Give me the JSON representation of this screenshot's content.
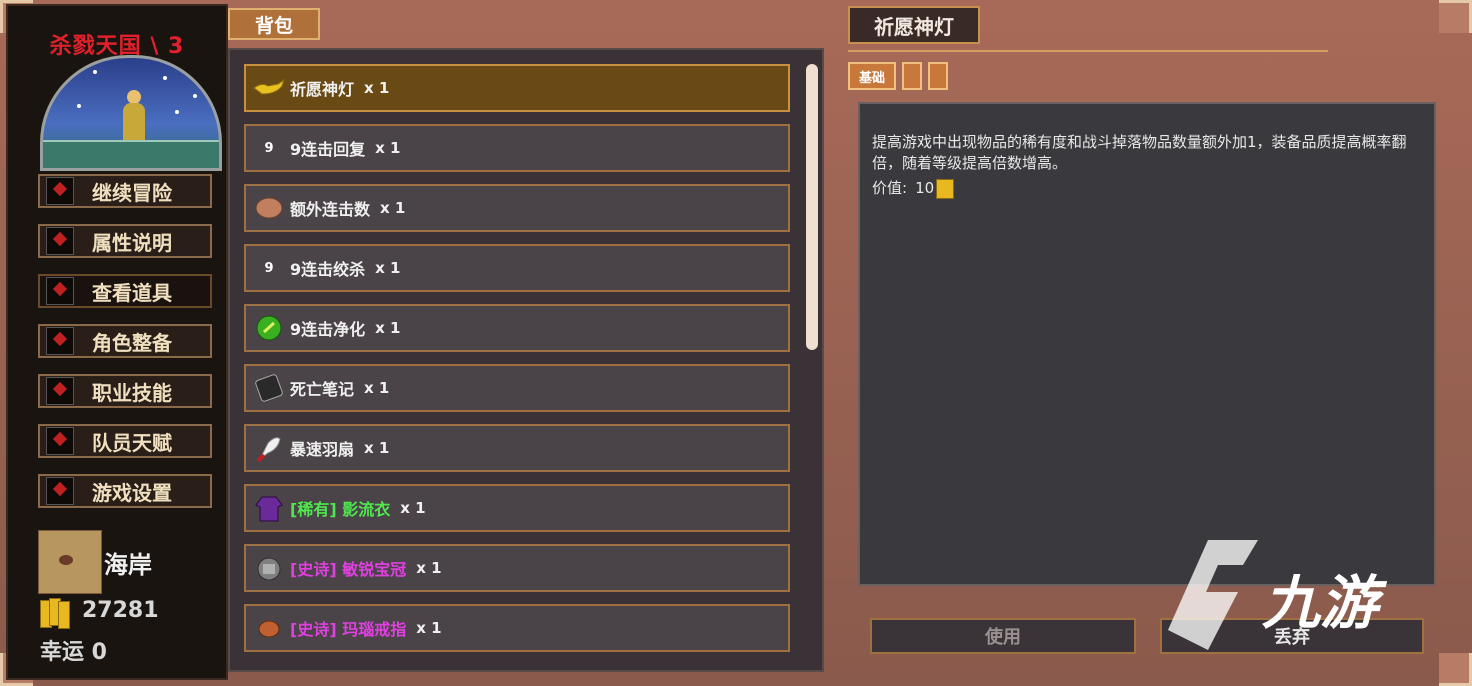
{
  "sidebar": {
    "title": "杀戮天国 \\ 3",
    "menu": [
      {
        "label": "继续冒险"
      },
      {
        "label": "属性说明"
      },
      {
        "label": "查看道具"
      },
      {
        "label": "角色整备"
      },
      {
        "label": "职业技能"
      },
      {
        "label": "队员天赋"
      },
      {
        "label": "游戏设置"
      }
    ],
    "active_index": 2,
    "location": "海岸",
    "gold": "27281",
    "luck": "幸运 0"
  },
  "inventory": {
    "tab_label": "背包",
    "items": [
      {
        "name": "祈愿神灯",
        "qty": "x 1",
        "icon": "magic-lamp-icon",
        "quality": "normal",
        "selected": true
      },
      {
        "name": "9连击回复",
        "qty": "x 1",
        "icon": "combo-heal-icon",
        "quality": "normal"
      },
      {
        "name": "额外连击数",
        "qty": "x 1",
        "icon": "rock-icon",
        "quality": "normal"
      },
      {
        "name": "9连击绞杀",
        "qty": "x 1",
        "icon": "combo-strangle-icon",
        "quality": "normal"
      },
      {
        "name": "9连击净化",
        "qty": "x 1",
        "icon": "green-orb-icon",
        "quality": "normal"
      },
      {
        "name": "死亡笔记",
        "qty": "x 1",
        "icon": "death-note-icon",
        "quality": "normal"
      },
      {
        "name": "暴速羽扇",
        "qty": "x 1",
        "icon": "feather-fan-icon",
        "quality": "normal"
      },
      {
        "name": "[稀有] 影流衣",
        "qty": "x 1",
        "icon": "robe-icon",
        "quality": "rare"
      },
      {
        "name": "[史诗] 敏锐宝冠",
        "qty": "x 1",
        "icon": "crown-icon",
        "quality": "epic"
      },
      {
        "name": "[史诗] 玛瑙戒指",
        "qty": "x 1",
        "icon": "ring-icon",
        "quality": "epic"
      }
    ]
  },
  "detail": {
    "title": "祈愿神灯",
    "tabs": [
      "基础",
      "",
      ""
    ],
    "description": "提高游戏中出现物品的稀有度和战斗掉落物品数量额外加1，装备品质提高概率翻倍，随着等级提高倍数增高。",
    "value_label": "价值:",
    "value": "10",
    "use_label": "使用",
    "discard_label": "丢弃"
  },
  "watermark": {
    "text": "九游"
  },
  "colors": {
    "title_red": "#e0202a",
    "rare_green": "#4ee84e",
    "epic_magenta": "#e040e0",
    "selected_row": "#6a4a14"
  }
}
